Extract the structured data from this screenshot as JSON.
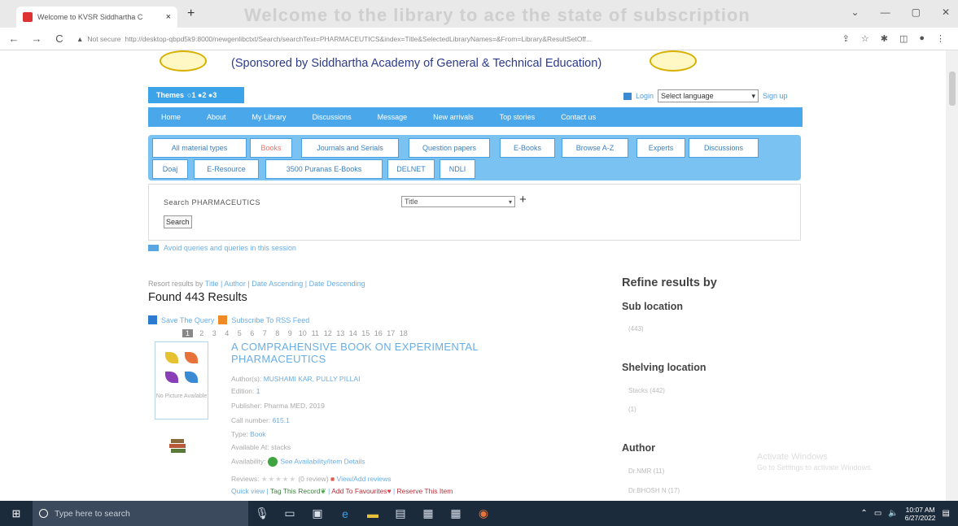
{
  "browser": {
    "tab_title": "Welcome to KVSR Siddhartha C",
    "tab_close": "×",
    "new_tab": "+",
    "ghost_heading": "Welcome to the library to ace the state of subscription",
    "window_controls": [
      "⌄",
      "—",
      "▢",
      "✕"
    ],
    "nav": {
      "back": "←",
      "forward": "→",
      "reload": "C"
    },
    "security_label": "Not secure",
    "url": "http://desktop-qbpd5k9:8000/newgenlibctxt/Search/searchText=PHARMACEUTICS&index=Title&SelectedLibraryNames=&From=Library&ResultSetOff..."
  },
  "header": {
    "sponsor_text": "(Sponsored by Siddhartha Academy of General & Technical Education)"
  },
  "themes": {
    "label": "Themes",
    "options": "○1 ●2 ●3"
  },
  "top_right": {
    "login": "Login",
    "language_placeholder": "Select language",
    "signup": "Sign up"
  },
  "menu": [
    "Home",
    "About",
    "My Library",
    "Discussions",
    "Message",
    "New arrivals",
    "Top stories",
    "Contact us"
  ],
  "material_tabs_row1": [
    "All material types",
    "Books",
    "Journals and Serials",
    "Question papers",
    "E-Books",
    "Browse A-Z",
    "Experts",
    "Discussions"
  ],
  "material_tabs_row2": [
    "Doaj",
    "E-Resource",
    "3500 Puranas E-Books",
    "DELNET",
    "NDLI"
  ],
  "search": {
    "label": "Search  PHARMACEUTICS",
    "field": "Title",
    "button": "Search",
    "add": "+"
  },
  "saved_queries_text": "Avoid queries and queries in this session",
  "results": {
    "sort_prefix": "Resort results by",
    "sort_options": "Title | Author | Date Ascending | Date Descending",
    "found": "Found 443 Results",
    "save_query": "Save The Query",
    "rss": "Subscribe To RSS Feed",
    "pages": [
      "1",
      "2",
      "3",
      "4",
      "5",
      "6",
      "7",
      "8",
      "9",
      "10",
      "11",
      "12",
      "13",
      "14",
      "15",
      "16",
      "17",
      "18"
    ]
  },
  "record": {
    "title": "A COMPRAHENSIVE BOOK ON EXPERIMENTAL PHARMACEUTICS",
    "no_picture": "No Picture Available",
    "authors_label": "Author(s):",
    "authors": "MUSHAMI KAR, PULLY PILLAI",
    "edition_label": "Edition:",
    "edition": "1",
    "publisher_label": "Publisher:",
    "publisher": "Pharma MED, 2019",
    "call_label": "Call number:",
    "call": "615.1",
    "type_label": "Type:",
    "type": "Book",
    "available_label": "Available At:",
    "available": "stacks",
    "availability_label": "Availability:",
    "availability": "See Availability/Item Details",
    "reviews_label": "Reviews:",
    "stars": "★★★★★",
    "reviews_count": "(0 review)",
    "reviews_action": "View/Add reviews",
    "actions": {
      "quick": "Quick view",
      "tag": "Tag This Record",
      "fav": "Add To Favourites",
      "reserve": "Reserve This Item"
    }
  },
  "refine": {
    "title": "Refine results by",
    "sub_location": "Sub location",
    "sub_values": [
      "(443)"
    ],
    "shelving": "Shelving location",
    "shelving_values": [
      "Stacks (442)",
      "(1)"
    ],
    "author": "Author",
    "author_values": [
      "Dr.NMR (11)",
      "Dr.BHOSH N (17)"
    ]
  },
  "watermark": {
    "line1": "Activate Windows",
    "line2": "Go to Settings to activate Windows."
  },
  "taskbar": {
    "search_placeholder": "Type here to search",
    "time": "10:07 AM",
    "date": "6/27/2022"
  }
}
